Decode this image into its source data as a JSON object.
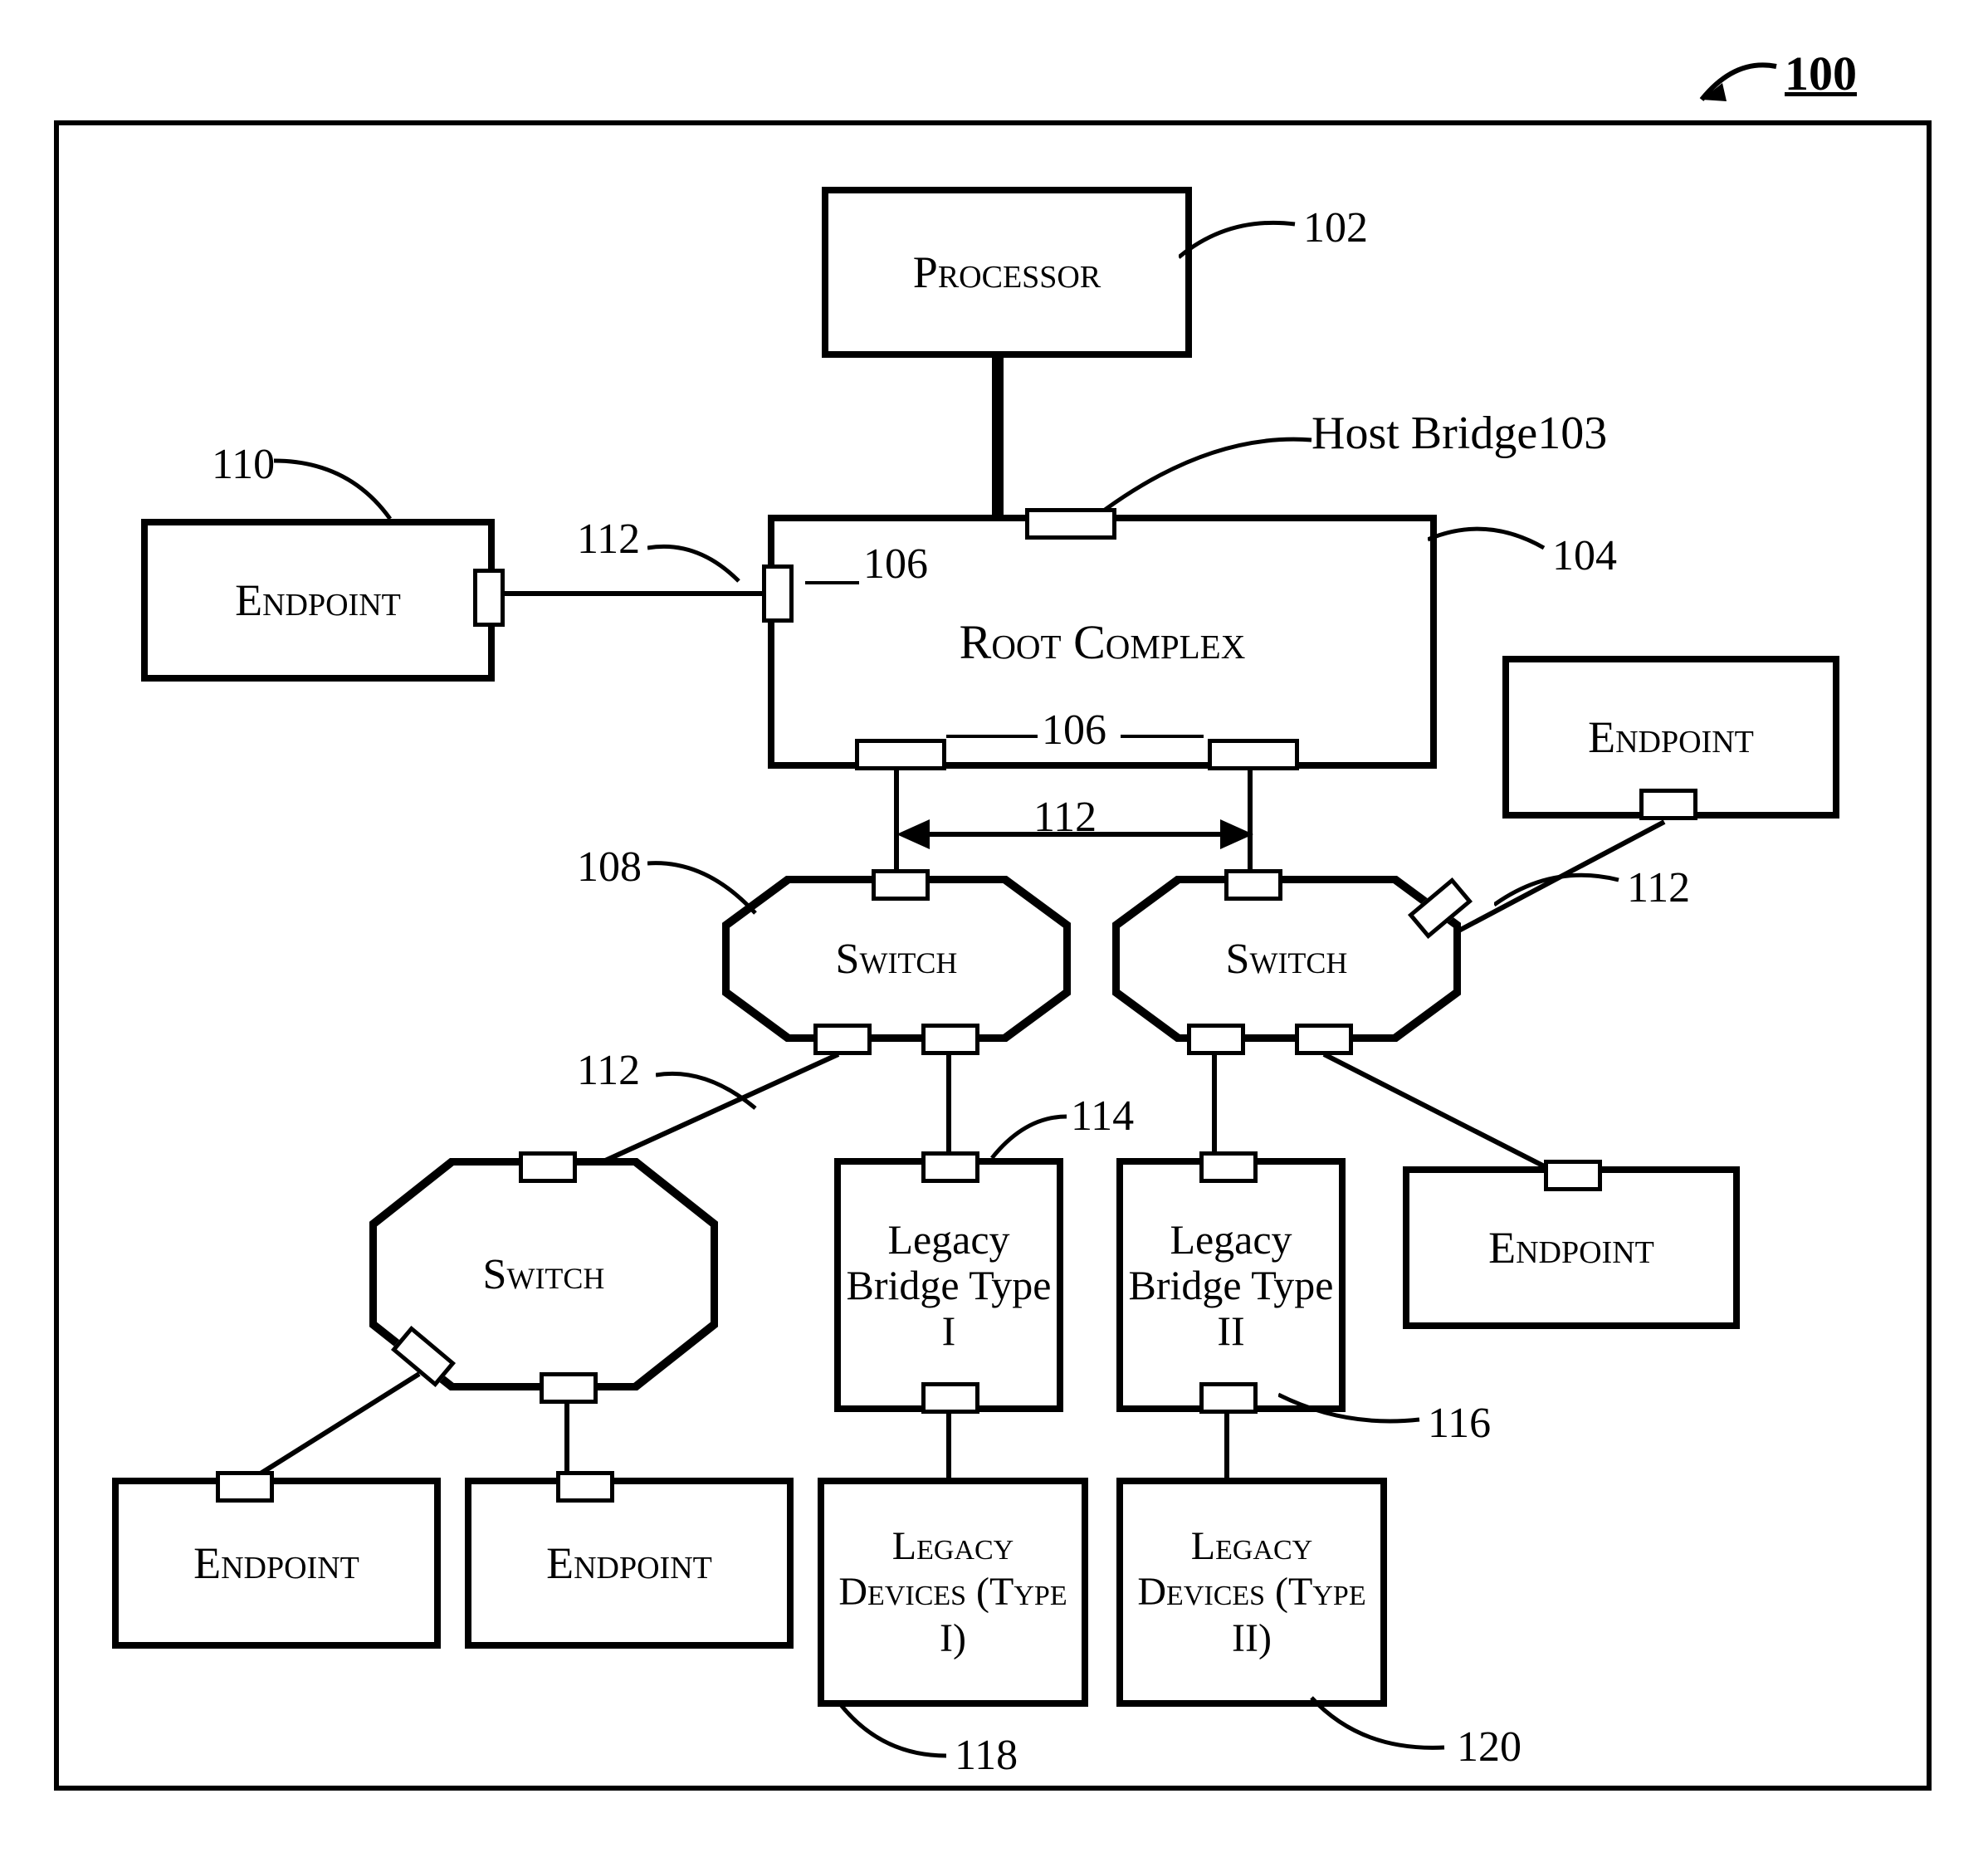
{
  "figure_id": "100",
  "labels": {
    "processor": "Processor",
    "root_complex": "Root Complex",
    "endpoint": "Endpoint",
    "switch": "Switch",
    "host_bridge": "Host Bridge103",
    "legacy_bridge_1": "Legacy Bridge Type I",
    "legacy_bridge_2": "Legacy Bridge Type II",
    "legacy_devices_1": "Legacy Devices (Type I)",
    "legacy_devices_2": "Legacy Devices (Type II)"
  },
  "refs": {
    "r102": "102",
    "r104": "104",
    "r106a": "106",
    "r106b": "106",
    "r108": "108",
    "r110": "110",
    "r112a": "112",
    "r112b": "112",
    "r112c": "112",
    "r112d": "112",
    "r114": "114",
    "r116": "116",
    "r118": "118",
    "r120": "120"
  }
}
